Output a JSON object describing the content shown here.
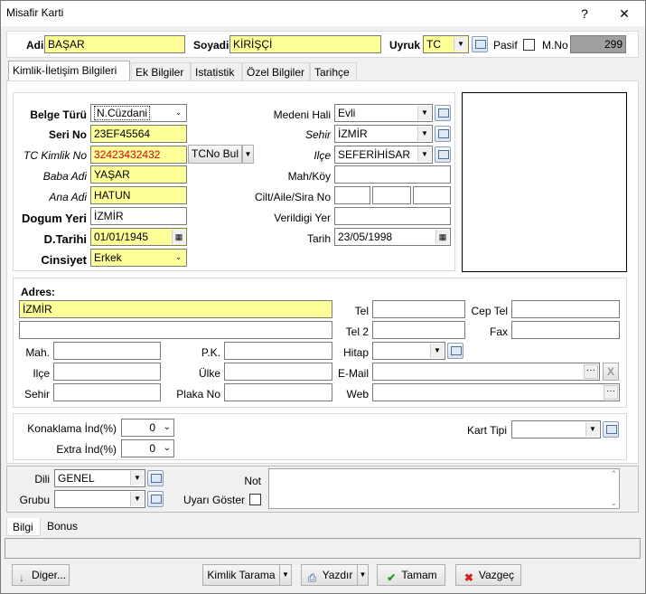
{
  "window": {
    "title": "Misafir Karti",
    "help": "?",
    "close": "✕"
  },
  "header": {
    "adi_label": "Adi",
    "adi_value": "BAŞAR",
    "soyadi_label": "Soyadi",
    "soyadi_value": "KİRİŞÇİ",
    "uyruk_label": "Uyruk",
    "uyruk_value": "TC",
    "pasif_label": "Pasif",
    "mno_label": "M.No",
    "mno_value": "299"
  },
  "tabs": [
    "Kimlik-İletişim Bilgileri",
    "Ek Bilgiler",
    "Istatistik",
    "Özel Bilgiler",
    "Tarihçe"
  ],
  "kimlik": {
    "belge_turu_label": "Belge Türü",
    "belge_turu_value": "N.Cüzdani",
    "seri_no_label": "Seri No",
    "seri_no_value": "23EF45564",
    "tc_kimlik_label": "TC Kimlik No",
    "tc_kimlik_value": "32423432432",
    "tcno_bul_label": "TCNo Bul",
    "baba_adi_label": "Baba Adi",
    "baba_adi_value": "YAŞAR",
    "ana_adi_label": "Ana Adi",
    "ana_adi_value": "HATUN",
    "dogum_yeri_label": "Dogum Yeri",
    "dogum_yeri_value": "İZMİR",
    "dtarihi_label": "D.Tarihi",
    "dtarihi_value": "01/01/1945",
    "cinsiyet_label": "Cinsiyet",
    "cinsiyet_value": "Erkek",
    "medeni_hali_label": "Medeni Hali",
    "medeni_hali_value": "Evli",
    "sehir_label": "Sehir",
    "sehir_value": "İZMİR",
    "ilce_label": "Ilçe",
    "ilce_value": "SEFERİHİSAR",
    "mah_koy_label": "Mah/Köy",
    "mah_koy_value": "",
    "cilt_label": "Cilt/Aile/Sira No",
    "verildigi_yer_label": "Verildigi Yer",
    "verildigi_yer_value": "",
    "tarih_label": "Tarih",
    "tarih_value": "23/05/1998"
  },
  "adres": {
    "adres_label": "Adres:",
    "adres1_value": "İZMİR",
    "adres2_value": "",
    "mah_label": "Mah.",
    "ilce_label": "Ilçe",
    "sehir_label": "Sehir",
    "pk_label": "P.K.",
    "ulke_label": "Ülke",
    "plaka_label": "Plaka No",
    "tel_label": "Tel",
    "tel2_label": "Tel 2",
    "hitap_label": "Hitap",
    "email_label": "E-Mail",
    "web_label": "Web",
    "cep_tel_label": "Cep Tel",
    "fax_label": "Fax"
  },
  "konaklama": {
    "konaklama_label": "Konaklama İnd(%)",
    "konaklama_value": "0",
    "extra_label": "Extra İnd(%)",
    "extra_value": "0",
    "kart_tipi_label": "Kart Tipi",
    "kart_tipi_value": ""
  },
  "bottom": {
    "dili_label": "Dili",
    "dili_value": "GENEL",
    "grubu_label": "Grubu",
    "grubu_value": "",
    "not_label": "Not",
    "uyari_label": "Uyarı Göster"
  },
  "bottom_tabs": [
    "Bilgi",
    "Bonus"
  ],
  "footer": {
    "diger_label": "Diger...",
    "kimlik_tarama_label": "Kimlik Tarama",
    "yazdir_label": "Yazdır",
    "tamam_label": "Tamam",
    "vazgec_label": "Vazgeç"
  }
}
